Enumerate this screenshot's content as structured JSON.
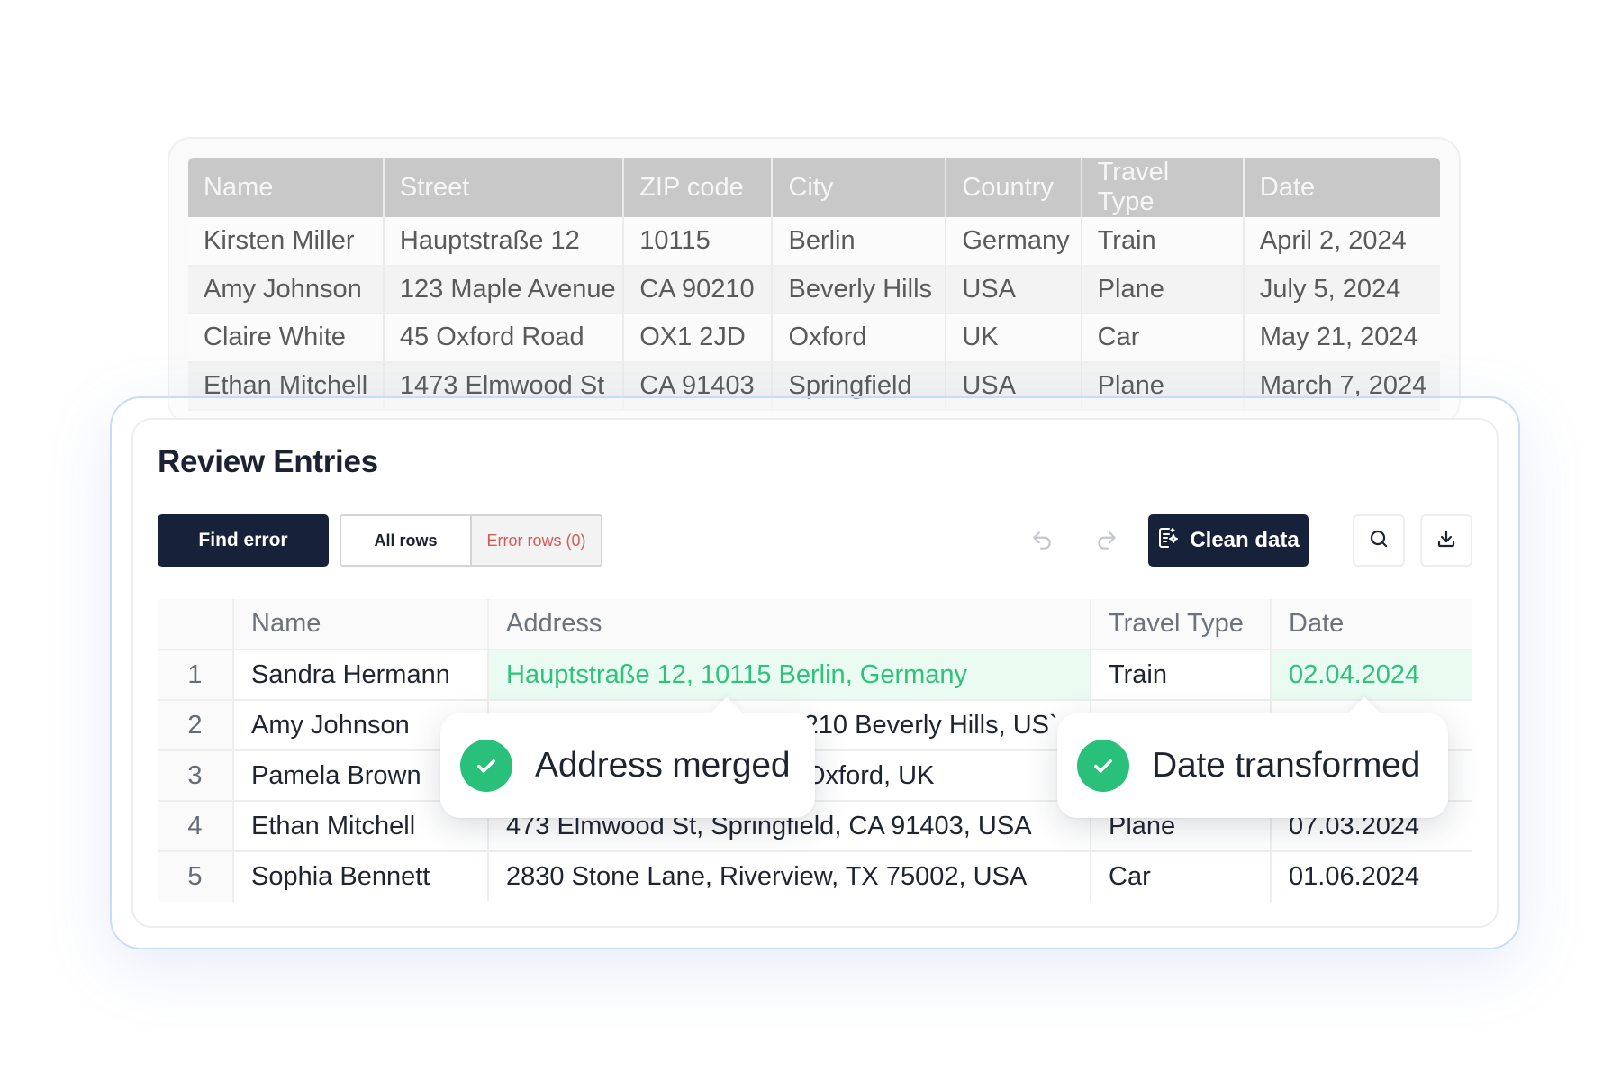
{
  "background_table": {
    "headers": [
      "Name",
      "Street",
      "ZIP code",
      "City",
      "Country",
      "Travel Type",
      "Date"
    ],
    "rows": [
      [
        "Kirsten Miller",
        "Hauptstraße 12",
        "10115",
        "Berlin",
        "Germany",
        "Train",
        "April 2, 2024"
      ],
      [
        "Amy Johnson",
        "123 Maple Avenue",
        "CA 90210",
        "Beverly Hills",
        "USA",
        "Plane",
        "July 5, 2024"
      ],
      [
        "Claire White",
        "45 Oxford Road",
        "OX1 2JD",
        "Oxford",
        "UK",
        "Car",
        "May 21, 2024"
      ],
      [
        "Ethan Mitchell",
        "1473 Elmwood St",
        "CA 91403",
        "Springfield",
        "USA",
        "Plane",
        "March 7, 2024"
      ]
    ]
  },
  "review": {
    "title": "Review Entries",
    "find_error_label": "Find error",
    "all_rows_label": "All rows",
    "error_rows_label": "Error rows (0)",
    "clean_data_label": "Clean data",
    "headers": [
      "",
      "Name",
      "Address",
      "Travel Type",
      "Date"
    ],
    "rows": [
      [
        "1",
        "Sandra Hermann",
        "Hauptstraße 12, 10115 Berlin, Germany",
        "Train",
        "02.04.2024"
      ],
      [
        "2",
        "Amy Johnson",
        "`210 Beverly Hills, US`",
        "",
        ""
      ],
      [
        "3",
        "Pamela Brown",
        "Oxford, UK",
        "",
        ""
      ],
      [
        "4",
        "Ethan Mitchell",
        "473 Elmwood St, Springfield, CA 91403, USA",
        "Plane",
        "07.03.2024"
      ],
      [
        "5",
        "Sophia Bennett",
        "2830 Stone Lane, Riverview, TX 75002, USA",
        "Car",
        "01.06.2024"
      ]
    ]
  },
  "toasts": {
    "address": "Address merged",
    "date": "Date transformed"
  },
  "colors": {
    "accent_dark": "#17213a",
    "success_green": "#28c07a",
    "highlight_text": "#2fc27d",
    "highlight_bg": "#eafbf1",
    "error_text": "#d55a5a"
  },
  "icons": {
    "undo": "undo-icon",
    "redo": "redo-icon",
    "clean": "sparkle-doc-icon",
    "search": "search-icon",
    "download": "download-icon",
    "check": "check-icon"
  }
}
